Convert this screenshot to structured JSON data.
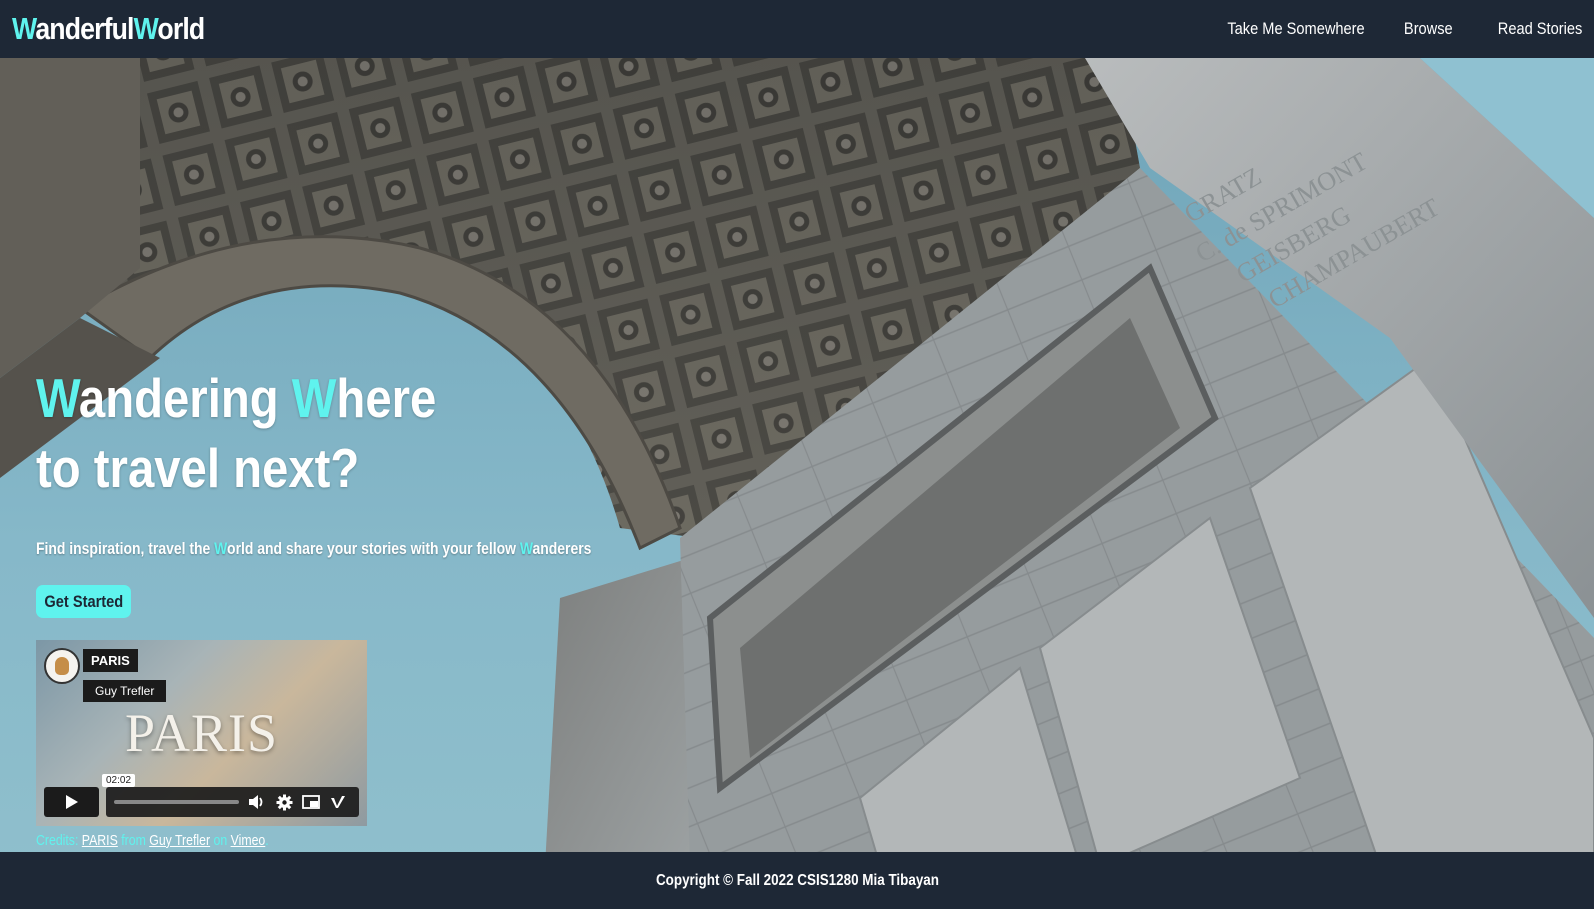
{
  "header": {
    "brand_w1": "W",
    "brand_mid": "anderful",
    "brand_w2": "W",
    "brand_end": "orld",
    "nav": [
      {
        "label": "Take Me Somewhere"
      },
      {
        "label": "Browse"
      },
      {
        "label": "Read Stories"
      }
    ]
  },
  "hero": {
    "title_w1": "W",
    "title_part1": "andering ",
    "title_w2": "W",
    "title_part2": "here",
    "title_line2": "to travel next?",
    "sub_part1": "Find inspiration, travel the ",
    "sub_w1": "W",
    "sub_part2": "orld and share your stories with your fellow ",
    "sub_w2": "W",
    "sub_part3": "anderers",
    "cta_label": "Get Started"
  },
  "video": {
    "title": "PARIS",
    "author": "Guy Trefler",
    "overlay_text": "PARIS",
    "time": "02:02",
    "progress": 0.0
  },
  "credits": {
    "prefix": "Credits: ",
    "video_link": "PARIS",
    "from": " from ",
    "author_link": "Guy Trefler",
    "on": " on ",
    "platform_link": "Vimeo",
    "end": "."
  },
  "footer": {
    "text": "Copyright © Fall 2022 CSIS1280 Mia Tibayan"
  },
  "colors": {
    "accent": "#5ff3ee",
    "navbar": "#1e2836"
  }
}
